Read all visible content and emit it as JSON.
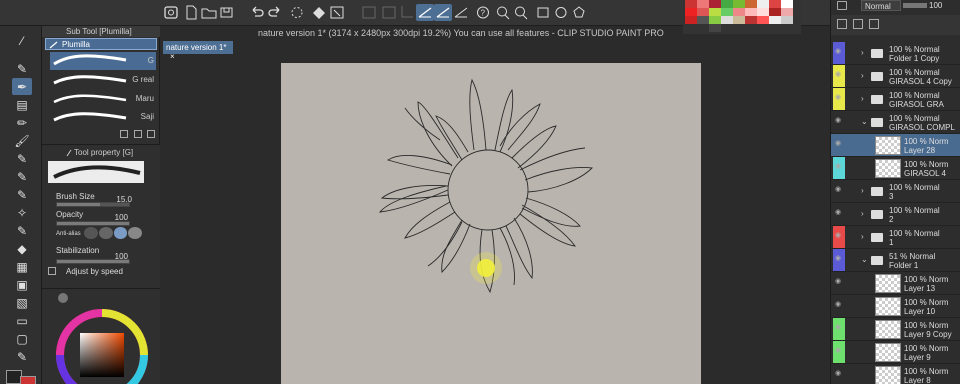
{
  "app": {
    "title": "nature version 1* (3174 x 2480px 300dpi 19.2%)  You can use all features - CLIP STUDIO PAINT PRO"
  },
  "document_tab": {
    "label": "nature version 1*",
    "close": "×"
  },
  "sub_tool": {
    "header": "Sub Tool [Plumilla]",
    "selected": "Plumilla",
    "brushes": [
      {
        "label": "G"
      },
      {
        "label": "G real"
      },
      {
        "label": "Maru"
      },
      {
        "label": "Saji"
      }
    ]
  },
  "tool_property": {
    "header": "Tool property [G]",
    "brush_size_label": "Brush Size",
    "brush_size_value": "15.0",
    "opacity_label": "Opacity",
    "opacity_value": "100",
    "anti_alias_label": "Anti-alias",
    "stabilization_label": "Stabilization",
    "stabilization_value": "100",
    "adjust_label": "Adjust by speed",
    "opacity_level": 1.0,
    "brush_size_level": 0.6,
    "stabilization_level": 1.0
  },
  "layer_panel": {
    "blend_mode": "Normal",
    "opacity": "100",
    "layers": [
      {
        "l1": "100 % Normal",
        "l2": "Folder 1 Copy",
        "type": "folder",
        "color": "#5b5bd6"
      },
      {
        "l1": "100 % Normal",
        "l2": "GIRASOL 4 Copy",
        "type": "folder",
        "color": "#e8e84a"
      },
      {
        "l1": "100 % Normal",
        "l2": "GIRASOL GRA",
        "type": "folder",
        "color": "#e8e84a"
      },
      {
        "l1": "100 % Normal",
        "l2": "GIRASOL COMPL",
        "type": "folder-open",
        "color": ""
      },
      {
        "l1": "100 % Norm",
        "l2": "Layer 28",
        "type": "layer",
        "color": "",
        "active": true
      },
      {
        "l1": "100 % Norm",
        "l2": "GIRASOL 4",
        "type": "layer",
        "color": "#5cd6d6"
      },
      {
        "l1": "100 % Normal",
        "l2": "3",
        "type": "folder",
        "color": ""
      },
      {
        "l1": "100 % Normal",
        "l2": "2",
        "type": "folder",
        "color": ""
      },
      {
        "l1": "100 % Normal",
        "l2": "1",
        "type": "folder",
        "color": "#e84a4a"
      },
      {
        "l1": "51 % Normal",
        "l2": "Folder 1",
        "type": "folder-open",
        "color": "#5b5bd6"
      },
      {
        "l1": "100 % Norm",
        "l2": "Layer 13",
        "type": "layer",
        "color": ""
      },
      {
        "l1": "100 % Norm",
        "l2": "Layer 10",
        "type": "layer",
        "color": ""
      },
      {
        "l1": "100 % Norm",
        "l2": "Layer 9 Copy",
        "type": "layer",
        "color": "#6ee06e"
      },
      {
        "l1": "100 % Norm",
        "l2": "Layer 9",
        "type": "layer",
        "color": "#6ee06e"
      },
      {
        "l1": "100 % Norm",
        "l2": "Layer 8",
        "type": "layer",
        "color": ""
      }
    ]
  },
  "colors": {
    "accent": "#4e6f94",
    "canvas_bg": "#bab4ae",
    "panel_bg": "#2f2f2f"
  }
}
